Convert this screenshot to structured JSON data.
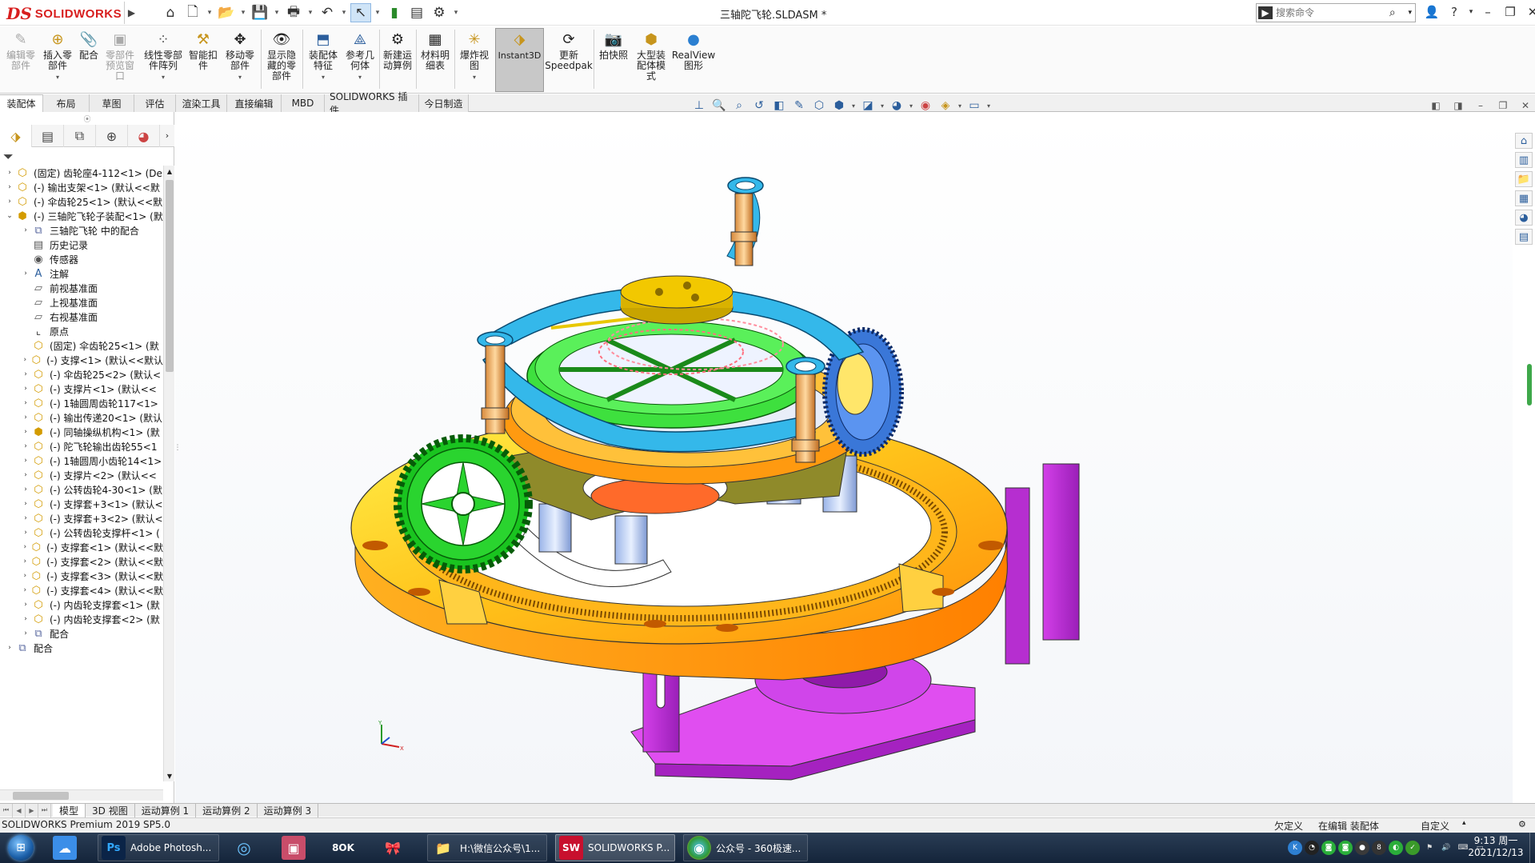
{
  "app": {
    "logo_ds": "DS",
    "logo_text": "SOLIDWORKS",
    "document_title": "三轴陀飞轮.SLDASM *",
    "search_placeholder": "搜索命令"
  },
  "ribbon": {
    "buttons": [
      {
        "label": "编辑零\n部件",
        "icon": "edit-component-icon",
        "enabled": false
      },
      {
        "label": "插入零\n部件",
        "icon": "insert-component-icon",
        "enabled": true
      },
      {
        "label": "配合",
        "icon": "mate-icon",
        "enabled": true
      },
      {
        "label": "零部件\n预览窗\n口",
        "icon": "preview-window-icon",
        "enabled": false
      },
      {
        "label": "线性零部\n件阵列",
        "icon": "linear-pattern-icon",
        "enabled": true
      },
      {
        "label": "智能扣\n件",
        "icon": "smart-fastener-icon",
        "enabled": true
      },
      {
        "label": "移动零\n部件",
        "icon": "move-component-icon",
        "enabled": true
      },
      {
        "label": "显示隐\n藏的零\n部件",
        "icon": "show-hidden-icon",
        "enabled": true
      },
      {
        "label": "装配体\n特征",
        "icon": "assembly-feature-icon",
        "enabled": true
      },
      {
        "label": "参考几\n何体",
        "icon": "reference-geometry-icon",
        "enabled": true
      },
      {
        "label": "新建运\n动算例",
        "icon": "motion-study-icon",
        "enabled": true
      },
      {
        "label": "材料明\n细表",
        "icon": "bom-icon",
        "enabled": true
      },
      {
        "label": "爆炸视\n图",
        "icon": "exploded-view-icon",
        "enabled": true
      },
      {
        "label": "Instant3D",
        "icon": "instant3d-icon",
        "enabled": true
      },
      {
        "label": "更新\nSpeedpak",
        "icon": "speedpak-icon",
        "enabled": true
      },
      {
        "label": "拍快照",
        "icon": "snapshot-icon",
        "enabled": true
      },
      {
        "label": "大型装\n配体模\n式",
        "icon": "large-assembly-icon",
        "enabled": true
      },
      {
        "label": "RealView\n图形",
        "icon": "realview-icon",
        "enabled": true
      }
    ]
  },
  "cm_tabs": [
    "装配体",
    "布局",
    "草图",
    "评估",
    "渲染工具",
    "直接编辑",
    "MBD",
    "SOLIDWORKS 插件",
    "今日制造"
  ],
  "tree": {
    "items": [
      {
        "label": "(固定) 齿轮座4-112<1> (De",
        "icon": "part",
        "level": 0,
        "expand": "closed"
      },
      {
        "label": "(-) 输出支架<1> (默认<<默",
        "icon": "part",
        "level": 0,
        "expand": "closed"
      },
      {
        "label": "(-) 伞齿轮25<1> (默认<<默",
        "icon": "part",
        "level": 0,
        "expand": "closed"
      },
      {
        "label": "(-) 三轴陀飞轮子装配<1> (默",
        "icon": "assy",
        "level": 0,
        "expand": "open"
      },
      {
        "label": "三轴陀飞轮 中的配合",
        "icon": "mate",
        "level": 1,
        "expand": "closed"
      },
      {
        "label": "历史记录",
        "icon": "history",
        "level": 1,
        "expand": "none"
      },
      {
        "label": "传感器",
        "icon": "sensor",
        "level": 1,
        "expand": "none"
      },
      {
        "label": "注解",
        "icon": "annotation",
        "level": 1,
        "expand": "closed"
      },
      {
        "label": "前视基准面",
        "icon": "plane",
        "level": 1,
        "expand": "none"
      },
      {
        "label": "上视基准面",
        "icon": "plane",
        "level": 1,
        "expand": "none"
      },
      {
        "label": "右视基准面",
        "icon": "plane",
        "level": 1,
        "expand": "none"
      },
      {
        "label": "原点",
        "icon": "origin",
        "level": 1,
        "expand": "none"
      },
      {
        "label": "(固定) 伞齿轮25<1> (默",
        "icon": "part",
        "level": 1,
        "expand": "none"
      },
      {
        "label": "(-) 支撑<1> (默认<<默认",
        "icon": "part",
        "level": 1,
        "expand": "closed"
      },
      {
        "label": "(-) 伞齿轮25<2> (默认<",
        "icon": "part",
        "level": 1,
        "expand": "closed"
      },
      {
        "label": "(-) 支撑片<1> (默认<<",
        "icon": "part",
        "level": 1,
        "expand": "closed"
      },
      {
        "label": "(-) 1轴圆周齿轮117<1>",
        "icon": "part",
        "level": 1,
        "expand": "closed"
      },
      {
        "label": "(-) 输出传递20<1> (默认",
        "icon": "part",
        "level": 1,
        "expand": "closed"
      },
      {
        "label": "(-) 同轴操纵机构<1> (默",
        "icon": "assy",
        "level": 1,
        "expand": "closed"
      },
      {
        "label": "(-) 陀飞轮输出齿轮55<1",
        "icon": "part",
        "level": 1,
        "expand": "closed"
      },
      {
        "label": "(-) 1轴圆周小齿轮14<1>",
        "icon": "part",
        "level": 1,
        "expand": "closed"
      },
      {
        "label": "(-) 支撑片<2> (默认<<",
        "icon": "part",
        "level": 1,
        "expand": "closed"
      },
      {
        "label": "(-) 公转齿轮4-30<1> (默",
        "icon": "part",
        "level": 1,
        "expand": "closed"
      },
      {
        "label": "(-) 支撑套+3<1> (默认<",
        "icon": "part",
        "level": 1,
        "expand": "closed"
      },
      {
        "label": "(-) 支撑套+3<2> (默认<",
        "icon": "part",
        "level": 1,
        "expand": "closed"
      },
      {
        "label": "(-) 公转齿轮支撑杆<1> (",
        "icon": "part",
        "level": 1,
        "expand": "closed"
      },
      {
        "label": "(-) 支撑套<1> (默认<<默",
        "icon": "part",
        "level": 1,
        "expand": "closed"
      },
      {
        "label": "(-) 支撑套<2> (默认<<默",
        "icon": "part",
        "level": 1,
        "expand": "closed"
      },
      {
        "label": "(-) 支撑套<3> (默认<<默",
        "icon": "part",
        "level": 1,
        "expand": "closed"
      },
      {
        "label": "(-) 支撑套<4> (默认<<默",
        "icon": "part",
        "level": 1,
        "expand": "closed"
      },
      {
        "label": "(-) 内齿轮支撑套<1> (默",
        "icon": "part",
        "level": 1,
        "expand": "closed"
      },
      {
        "label": "(-) 内齿轮支撑套<2> (默",
        "icon": "part",
        "level": 1,
        "expand": "closed"
      },
      {
        "label": "配合",
        "icon": "mate",
        "level": 1,
        "expand": "closed"
      },
      {
        "label": "配合",
        "icon": "mate",
        "level": 0,
        "expand": "closed"
      }
    ]
  },
  "bottom_tabs": [
    "模型",
    "3D 视图",
    "运动算例 1",
    "运动算例 2",
    "运动算例 3"
  ],
  "status": {
    "product": "SOLIDWORKS Premium 2019 SP5.0",
    "state": "欠定义",
    "editing": "在编辑 装配体",
    "units": "自定义"
  },
  "taskbar": {
    "apps": [
      {
        "label": "",
        "icon": "baidu-netdisk-icon",
        "color": "#3b8ee8"
      },
      {
        "label": "Adobe Photosh...",
        "icon": "photoshop-icon",
        "color": "#0b2447"
      },
      {
        "label": "",
        "icon": "browser-ring-icon",
        "color": "#2d7fd1"
      },
      {
        "label": "",
        "icon": "media-app-icon",
        "color": "#c84d6a"
      },
      {
        "label": "",
        "icon": "bok-app-icon",
        "color": "#222"
      },
      {
        "label": "",
        "icon": "ribbon-app-icon",
        "color": "#556"
      },
      {
        "label": "H:\\微信公众号\\1...",
        "icon": "folder-icon",
        "color": "#e7c14d"
      },
      {
        "label": "SOLIDWORKS P...",
        "icon": "solidworks-icon",
        "color": "#c8102e"
      },
      {
        "label": "公众号 - 360极速...",
        "icon": "360-browser-icon",
        "color": "#2f9a3a"
      }
    ],
    "time": "9:13 周一",
    "date": "2021/12/13"
  }
}
